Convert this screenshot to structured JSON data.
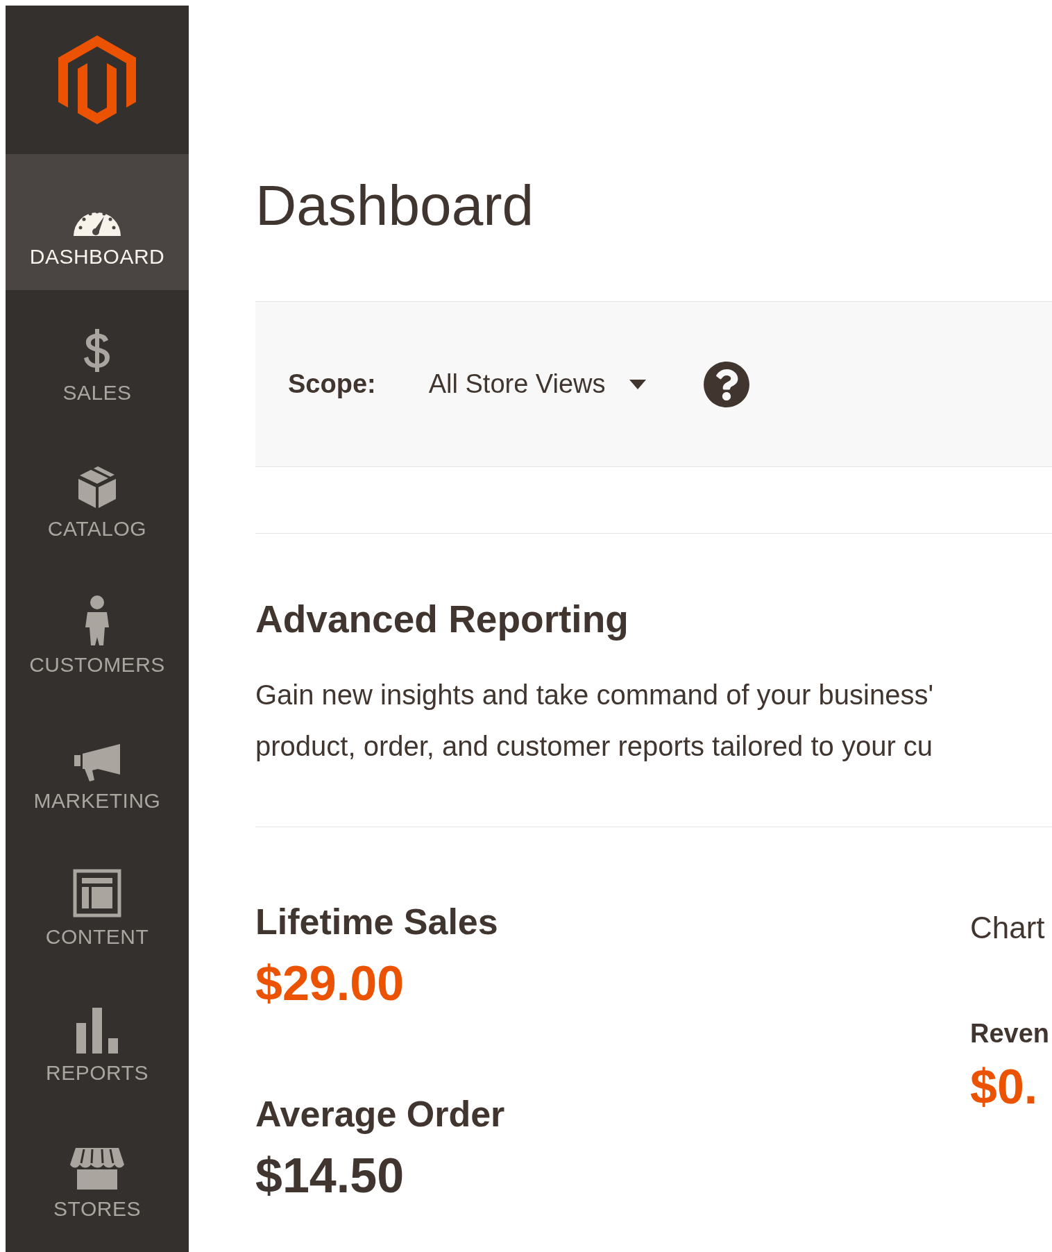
{
  "sidebar": {
    "items": [
      {
        "label": "DASHBOARD",
        "kind": "dashboard",
        "selected": true
      },
      {
        "label": "SALES",
        "kind": "sales",
        "selected": false
      },
      {
        "label": "CATALOG",
        "kind": "catalog",
        "selected": false
      },
      {
        "label": "CUSTOMERS",
        "kind": "customers",
        "selected": false
      },
      {
        "label": "MARKETING",
        "kind": "marketing",
        "selected": false
      },
      {
        "label": "CONTENT",
        "kind": "content",
        "selected": false
      },
      {
        "label": "REPORTS",
        "kind": "reports",
        "selected": false
      },
      {
        "label": "STORES",
        "kind": "stores",
        "selected": false
      }
    ]
  },
  "page_title": "Dashboard",
  "scope": {
    "label": "Scope:",
    "value": "All Store Views"
  },
  "advanced_reporting": {
    "title": "Advanced Reporting",
    "lines": [
      "Gain new insights and take command of your business'",
      "product, order, and customer reports tailored to your cu"
    ]
  },
  "stats": [
    {
      "label": "Lifetime Sales",
      "value": "$29.00",
      "highlight": true
    },
    {
      "label": "Average Order",
      "value": "$14.50",
      "highlight": false
    }
  ],
  "chart_panel": {
    "title": "Chart",
    "totals": [
      {
        "label": "Reven",
        "value": "$0.",
        "highlight": true
      }
    ]
  }
}
